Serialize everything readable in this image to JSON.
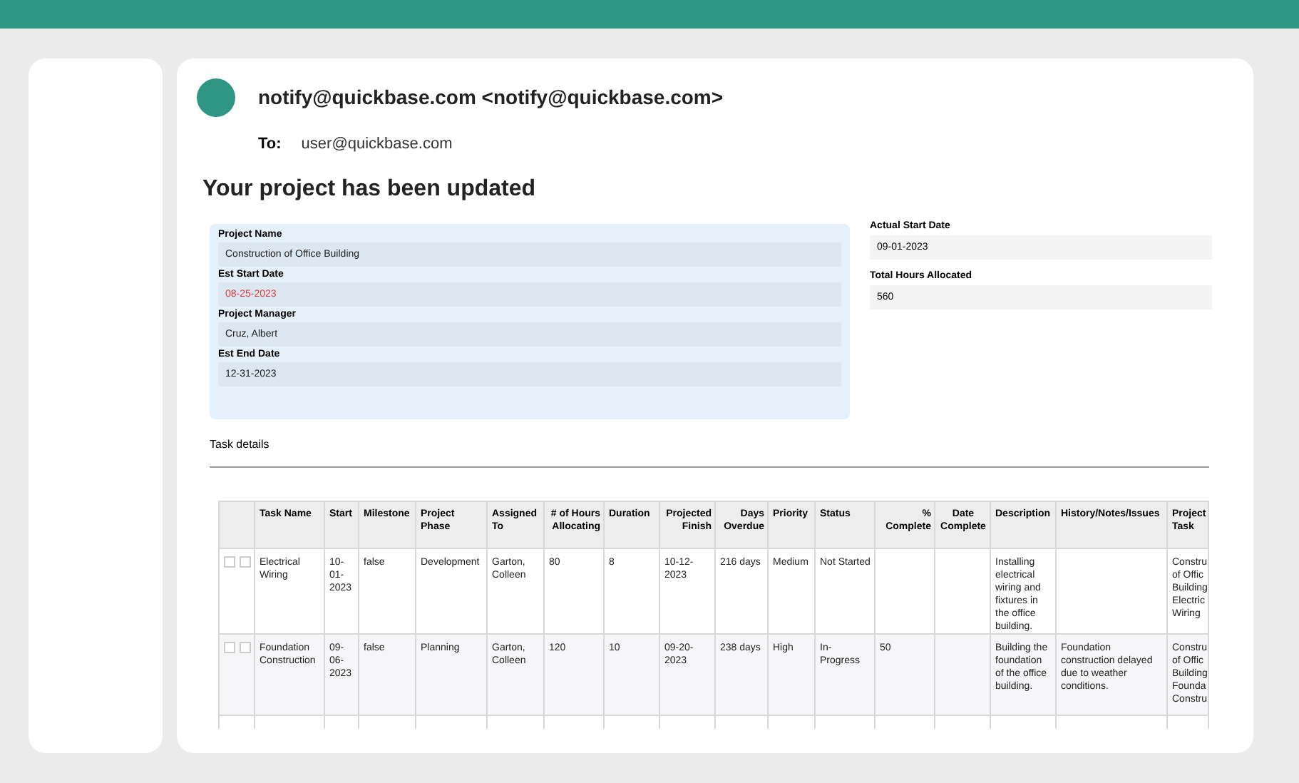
{
  "email": {
    "from": "notify@quickbase.com <notify@quickbase.com>",
    "to_label": "To:",
    "to": "user@quickbase.com",
    "heading": "Your project has been updated"
  },
  "left_fields": [
    {
      "label": "Project Name",
      "value": "Construction of Office Building",
      "highlight": false
    },
    {
      "label": "Est Start Date",
      "value": "08-25-2023",
      "highlight": true
    },
    {
      "label": "Project Manager",
      "value": "Cruz, Albert",
      "highlight": false
    },
    {
      "label": "Est End Date",
      "value": "12-31-2023",
      "highlight": false
    }
  ],
  "right_fields": [
    {
      "label": "Actual Start Date",
      "value": "09-01-2023"
    },
    {
      "label": "Total Hours Allocated",
      "value": "560"
    }
  ],
  "section_title": "Task details",
  "table": {
    "columns": [
      {
        "label": "Task Name"
      },
      {
        "label": "Start"
      },
      {
        "label": "Milestone"
      },
      {
        "label": "Project Phase"
      },
      {
        "label": "Assigned To"
      },
      {
        "label": "# of Hours Allocating"
      },
      {
        "label": "Duration"
      },
      {
        "label": "Projected Finish"
      },
      {
        "label": "Days Overdue"
      },
      {
        "label": "Priority"
      },
      {
        "label": "Status"
      },
      {
        "label": "% Complete"
      },
      {
        "label": "Date Complete"
      },
      {
        "label": "Description"
      },
      {
        "label": "History/Notes/Issues"
      },
      {
        "label": "Project\nTask"
      }
    ],
    "rows": [
      {
        "checks": [
          false,
          false
        ],
        "cells": [
          "Electrical Wiring",
          "10-01-2023",
          "false",
          "Development",
          "Garton, Colleen",
          "80",
          "8",
          "10-12-2023",
          "216 days",
          "Medium",
          "Not Started",
          "",
          "",
          "Installing electrical wiring and fixtures in the office building.",
          "",
          "Constru\nof Offic\nBuilding\nElectric\nWiring"
        ]
      },
      {
        "checks": [
          false,
          false
        ],
        "cells": [
          "Foundation Construction",
          "09-06-2023",
          "false",
          "Planning",
          "Garton, Colleen",
          "120",
          "10",
          "09-20-2023",
          "238 days",
          "High",
          "In-Progress",
          "50",
          "",
          "Building the foundation of the office building.",
          "Foundation construction delayed due to weather conditions.",
          "Constru\nof Offic\nBuilding\nFounda\nConstru"
        ]
      }
    ]
  }
}
